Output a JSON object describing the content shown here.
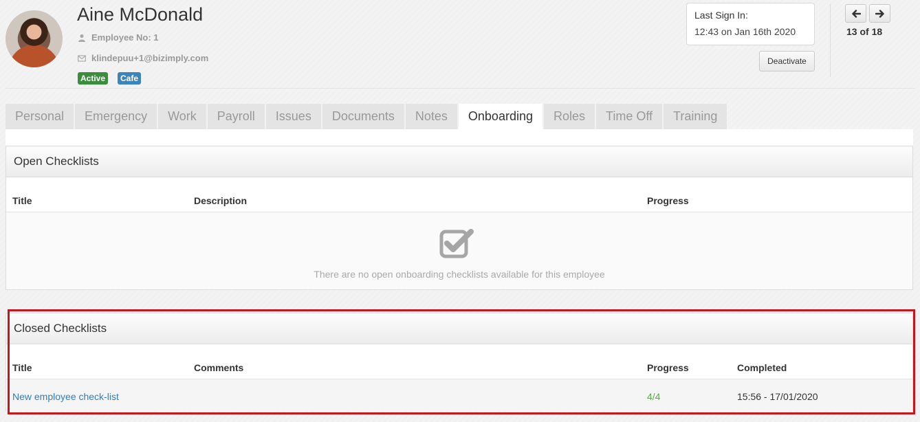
{
  "employee": {
    "name": "Aine McDonald",
    "employee_no": "Employee No: 1",
    "email": "klindepuu+1@bizimply.com",
    "badges": {
      "status": "Active",
      "location": "Cafe"
    }
  },
  "signin": {
    "label": "Last Sign In:",
    "value": "12:43 on Jan 16th 2020",
    "deactivate_label": "Deactivate"
  },
  "pager": {
    "text": "13 of 18"
  },
  "tabs": [
    {
      "label": "Personal"
    },
    {
      "label": "Emergency"
    },
    {
      "label": "Work"
    },
    {
      "label": "Payroll"
    },
    {
      "label": "Issues"
    },
    {
      "label": "Documents"
    },
    {
      "label": "Notes"
    },
    {
      "label": "Onboarding",
      "selected": true
    },
    {
      "label": "Roles"
    },
    {
      "label": "Time Off"
    },
    {
      "label": "Training"
    }
  ],
  "open_checklists": {
    "title": "Open Checklists",
    "columns": {
      "title": "Title",
      "description": "Description",
      "progress": "Progress"
    },
    "empty_text": "There are no open onboarding checklists available for this employee"
  },
  "closed_checklists": {
    "title": "Closed Checklists",
    "columns": {
      "title": "Title",
      "comments": "Comments",
      "progress": "Progress",
      "completed": "Completed"
    },
    "rows": [
      {
        "title": "New employee check-list",
        "comments": "",
        "progress": "4/4",
        "completed": "15:56 - 17/01/2020"
      }
    ]
  },
  "colors": {
    "active_badge": "#3b8c3d",
    "cafe_badge": "#3d85b8",
    "link": "#2f7dbd",
    "progress_complete": "#52b043",
    "highlight": "#c4161c"
  },
  "icons": {
    "user": "user-icon",
    "email": "envelope-icon",
    "prev": "arrow-left-icon",
    "next": "arrow-right-icon",
    "empty": "checkbox-checked-icon"
  }
}
